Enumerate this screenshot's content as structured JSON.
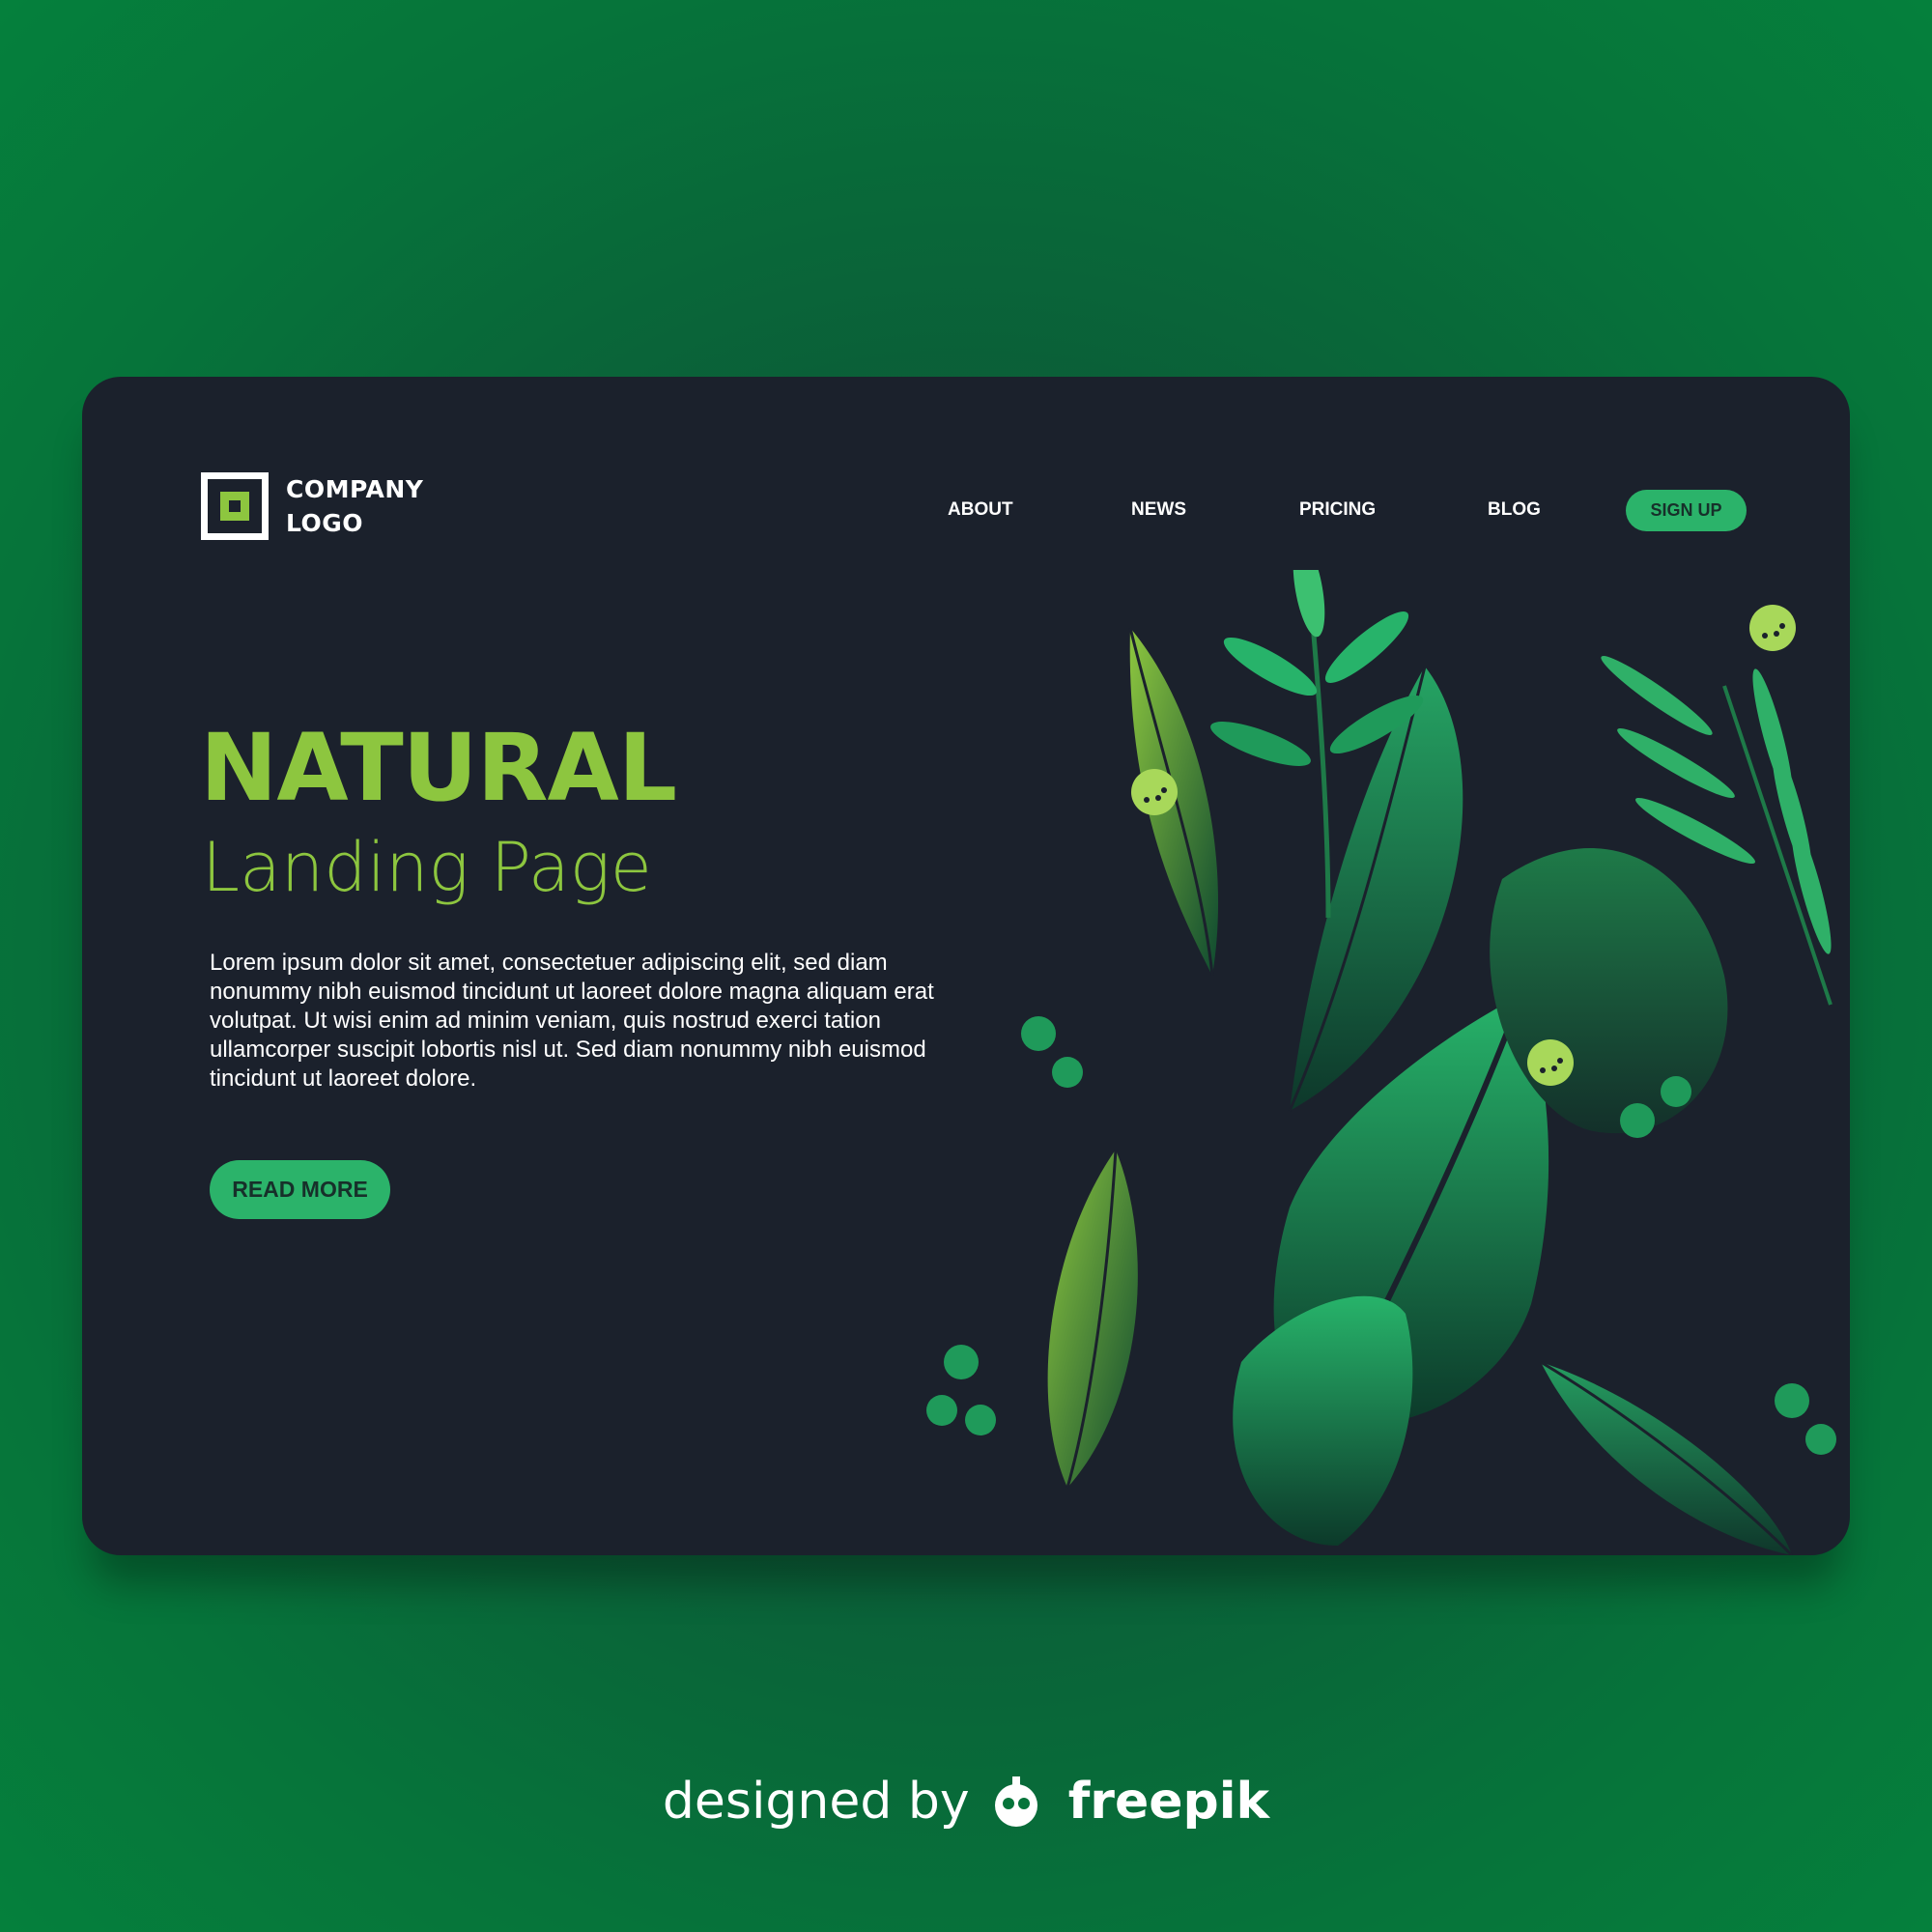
{
  "logo": {
    "line1": "COMPANY",
    "line2": "LOGO"
  },
  "nav": {
    "items": [
      {
        "label": "ABOUT"
      },
      {
        "label": "NEWS"
      },
      {
        "label": "PRICING"
      },
      {
        "label": "BLOG"
      }
    ],
    "signup_label": "SIGN UP"
  },
  "hero": {
    "title": "NATURAL",
    "subtitle": "Landing Page",
    "body": "Lorem ipsum dolor sit amet, consectetuer adipiscing elit, sed diam nonummy nibh euismod tincidunt ut laoreet dolore magna aliquam erat volutpat. Ut wisi enim ad minim veniam, quis nostrud exerci tation ullamcorper suscipit lobortis nisl ut. Sed diam nonummy nibh euismod tincidunt ut laoreet dolore.",
    "button_label": "READ MORE"
  },
  "credit": {
    "prefix": "designed by",
    "brand": "freepik",
    "icon": "freepik-mascot-icon"
  },
  "colors": {
    "accent_green": "#8dc63f",
    "button_green": "#2bb36a",
    "card_background": "#1b212c",
    "page_background": "#0a5a36"
  }
}
